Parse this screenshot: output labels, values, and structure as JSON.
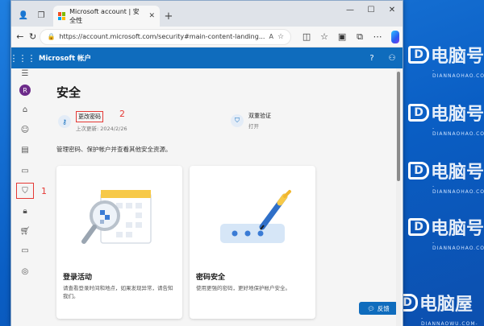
{
  "browser": {
    "tab_title": "Microsoft account | 安全性",
    "url": "https://account.microsoft.com/security#main-content-landing..."
  },
  "header": {
    "brand": "Microsoft 帐户",
    "help_icon": "?",
    "user_icon": "person-icon"
  },
  "page": {
    "title": "安全",
    "quick_links": [
      {
        "title": "更改密码",
        "subtitle": "上次更新: 2024/2/26",
        "icon": "key-icon"
      },
      {
        "title": "双重验证",
        "subtitle": "打开",
        "icon": "shield-people-icon"
      }
    ],
    "description": "管理密码、保护帐户并查看其他安全资源。",
    "cards": [
      {
        "title": "登录活动",
        "desc": "请查看登录时间和地点，如果发现异常，请告知我们。"
      },
      {
        "title": "密码安全",
        "desc": "使用更强的密码，更好地保护帐户安全。"
      }
    ]
  },
  "sidebar": {
    "avatar_letter": "R",
    "items": [
      "home-icon",
      "person-icon",
      "card-info-icon",
      "device-icon",
      "shield-icon",
      "lock-icon",
      "cart-icon",
      "payment-icon",
      "location-icon"
    ]
  },
  "annotations": {
    "sidebar": "1",
    "change_password": "2"
  },
  "feedback": {
    "label": "反馈"
  },
  "watermark": {
    "brand": "电脑号",
    "url": "-DIANNAOHAO.COM-",
    "brand_bottom": "电脑屋",
    "url_bottom": "-DIANNAOWU.COM-"
  },
  "colors": {
    "accent": "#0f6cbd",
    "highlight": "#e53935",
    "avatar": "#6d2b8a"
  }
}
